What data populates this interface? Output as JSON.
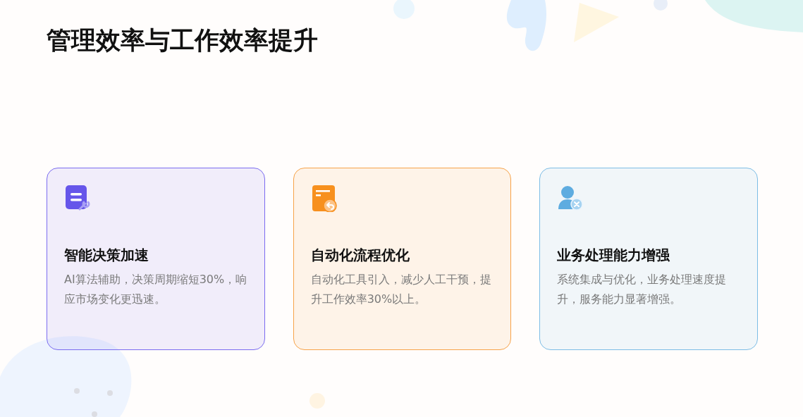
{
  "title": "管理效率与工作效率提升",
  "cards": [
    {
      "kind": "document-wrench",
      "color": "#7b6cf0",
      "title": "智能决策加速",
      "description": "AI算法辅助，决策周期缩短30%，响应市场变化更迅速。"
    },
    {
      "kind": "document-return",
      "color": "#f7a34a",
      "title": "自动化流程优化",
      "description": "自动化工具引入，减少人工干预，提升工作效率30%以上。"
    },
    {
      "kind": "user-remove",
      "color": "#7dbde6",
      "title": "业务处理能力增强",
      "description": "系统集成与优化，业务处理速度提升，服务能力显著增强。"
    }
  ]
}
